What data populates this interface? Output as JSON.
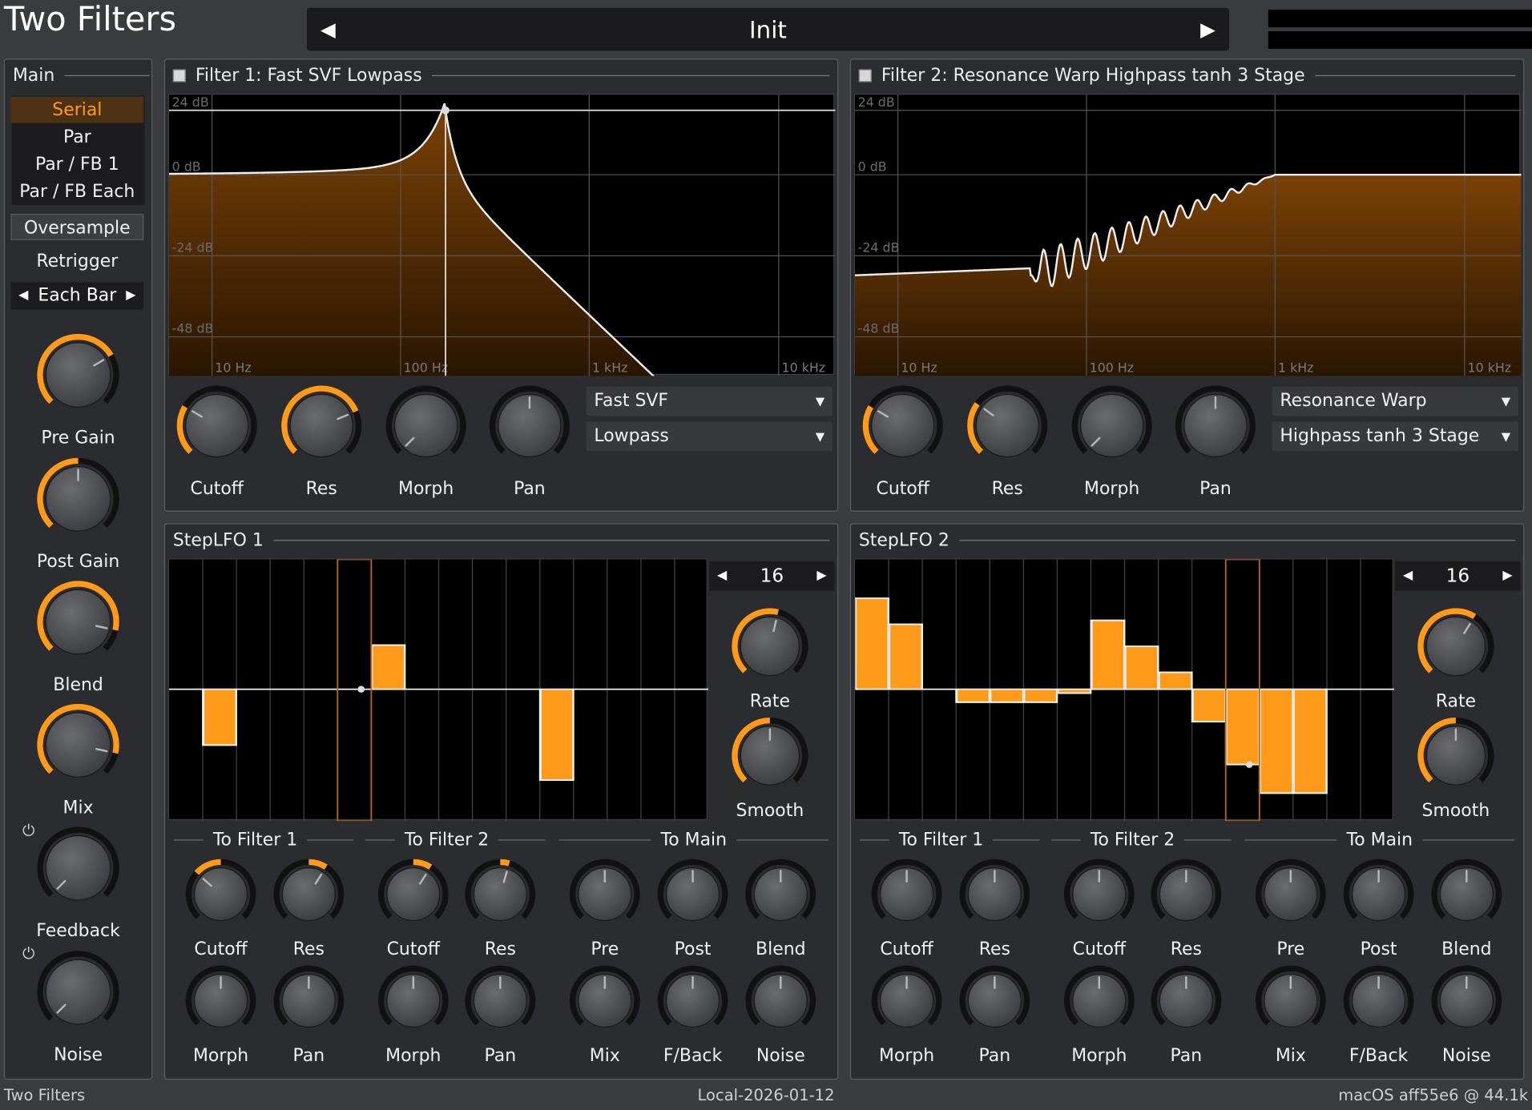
{
  "header": {
    "title": "Two Filters",
    "preset_name": "Init",
    "prev_icon": "triangle-left-icon",
    "next_icon": "triangle-right-icon"
  },
  "main": {
    "title": "Main",
    "routing": [
      "Serial",
      "Par",
      "Par / FB 1",
      "Par / FB Each"
    ],
    "routing_selected": "Serial",
    "oversample_label": "Oversample",
    "retrigger_label": "Retrigger",
    "retrigger_value": "Each Bar",
    "knobs": [
      {
        "label": "Pre Gain",
        "value": 0.72
      },
      {
        "label": "Post Gain",
        "value": 0.5
      },
      {
        "label": "Blend",
        "value": 0.88
      },
      {
        "label": "Mix",
        "value": 0.88
      },
      {
        "label": "Feedback",
        "value": 0.0
      },
      {
        "label": "Noise",
        "value": 0.0
      }
    ]
  },
  "filter1": {
    "title": "Filter 1: Fast SVF Lowpass",
    "model": "Fast SVF",
    "mode": "Lowpass",
    "db_labels": [
      "24 dB",
      "0 dB",
      "-24 dB",
      "-48 dB"
    ],
    "freq_labels": [
      "10 Hz",
      "100 Hz",
      "1 kHz",
      "10 kHz"
    ],
    "knobs": [
      {
        "label": "Cutoff",
        "value": 0.28
      },
      {
        "label": "Res",
        "value": 0.75
      },
      {
        "label": "Morph",
        "value": 0.0
      },
      {
        "label": "Pan",
        "value": 0.5
      }
    ]
  },
  "filter2": {
    "title": "Filter 2: Resonance Warp Highpass tanh 3 Stage",
    "model": "Resonance Warp",
    "mode": "Highpass tanh 3 Stage",
    "db_labels": [
      "24 dB",
      "0 dB",
      "-24 dB",
      "-48 dB"
    ],
    "freq_labels": [
      "10 Hz",
      "100 Hz",
      "1 kHz",
      "10 kHz"
    ],
    "knobs": [
      {
        "label": "Cutoff",
        "value": 0.28
      },
      {
        "label": "Res",
        "value": 0.3
      },
      {
        "label": "Morph",
        "value": 0.0
      },
      {
        "label": "Pan",
        "value": 0.5
      }
    ]
  },
  "lfo1": {
    "title": "StepLFO 1",
    "steps": "16",
    "rate_label": "Rate",
    "smooth_label": "Smooth",
    "rate_value": 0.55,
    "smooth_value": 0.5,
    "step_values": [
      0,
      -0.43,
      0,
      0,
      0,
      0,
      0.34,
      0,
      0,
      0,
      0,
      -0.7,
      0,
      0,
      0,
      0
    ],
    "active_step": 5,
    "sections": [
      "To Filter 1",
      "To Filter 2",
      "To Main"
    ],
    "row1": [
      {
        "label": "Cutoff",
        "value": 0.32
      },
      {
        "label": "Res",
        "value": 0.62
      },
      {
        "label": "Cutoff",
        "value": 0.62
      },
      {
        "label": "Res",
        "value": 0.56
      },
      {
        "label": "Pre",
        "value": 0.5
      },
      {
        "label": "Post",
        "value": 0.5
      },
      {
        "label": "Blend",
        "value": 0.5
      }
    ],
    "row2": [
      {
        "label": "Morph",
        "value": 0.5
      },
      {
        "label": "Pan",
        "value": 0.5
      },
      {
        "label": "Morph",
        "value": 0.5
      },
      {
        "label": "Pan",
        "value": 0.5
      },
      {
        "label": "Mix",
        "value": 0.5
      },
      {
        "label": "F/Back",
        "value": 0.5
      },
      {
        "label": "Noise",
        "value": 0.5
      }
    ]
  },
  "lfo2": {
    "title": "StepLFO 2",
    "steps": "16",
    "rate_label": "Rate",
    "smooth_label": "Smooth",
    "rate_value": 0.62,
    "smooth_value": 0.5,
    "step_values": [
      0.7,
      0.5,
      0,
      -0.1,
      -0.1,
      -0.1,
      -0.03,
      0.53,
      0.33,
      0.13,
      -0.25,
      -0.58,
      -0.8,
      -0.8,
      0,
      0
    ],
    "active_step": 11,
    "sections": [
      "To Filter 1",
      "To Filter 2",
      "To Main"
    ],
    "row1": [
      {
        "label": "Cutoff",
        "value": 0.5
      },
      {
        "label": "Res",
        "value": 0.5
      },
      {
        "label": "Cutoff",
        "value": 0.5
      },
      {
        "label": "Res",
        "value": 0.5
      },
      {
        "label": "Pre",
        "value": 0.5
      },
      {
        "label": "Post",
        "value": 0.5
      },
      {
        "label": "Blend",
        "value": 0.5
      }
    ],
    "row2": [
      {
        "label": "Morph",
        "value": 0.5
      },
      {
        "label": "Pan",
        "value": 0.5
      },
      {
        "label": "Morph",
        "value": 0.5
      },
      {
        "label": "Pan",
        "value": 0.5
      },
      {
        "label": "Mix",
        "value": 0.5
      },
      {
        "label": "F/Back",
        "value": 0.5
      },
      {
        "label": "Noise",
        "value": 0.5
      }
    ]
  },
  "status": {
    "left": "Two Filters",
    "center": "Local-2026-01-12",
    "right": "macOS aff55e6 @ 44.1k"
  },
  "colors": {
    "accent": "#ff9a1a",
    "panel": "#2b2c2f",
    "bg": "#3a3b3f"
  }
}
